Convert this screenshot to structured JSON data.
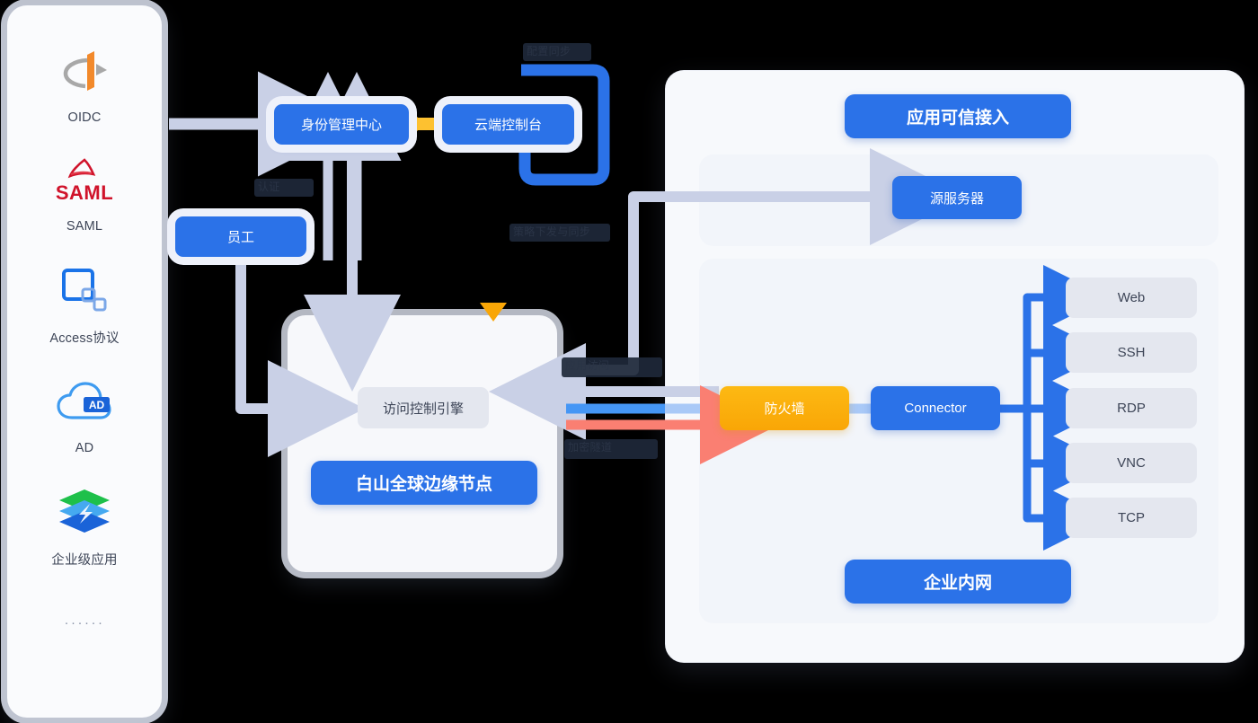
{
  "sidebar": {
    "items": [
      {
        "icon": "oidc-icon",
        "label": "OIDC"
      },
      {
        "icon": "saml-icon",
        "label": "SAML"
      },
      {
        "icon": "access-proto-icon",
        "label": "Access协议"
      },
      {
        "icon": "ad-icon",
        "label": "AD"
      },
      {
        "icon": "enterprise-app-icon",
        "label": "企业级应用"
      }
    ],
    "more": "······"
  },
  "nodes": {
    "identity_center": "身份管理中心",
    "cloud_console": "云端控制台",
    "employee": "员工",
    "access_control_engine": "访问控制引擎",
    "edge_node": "白山全球边缘节点",
    "trusted_access": "应用可信接入",
    "origin_server": "源服务器",
    "firewall": "防火墙",
    "connector": "Connector",
    "intranet": "企业内网"
  },
  "protocols": [
    {
      "label": "Web"
    },
    {
      "label": "SSH"
    },
    {
      "label": "RDP"
    },
    {
      "label": "VNC"
    },
    {
      "label": "TCP"
    }
  ],
  "edge_labels": {
    "console_loop": "配置同步",
    "employee_auth": "认证",
    "policy_push": "策略下发与同步",
    "app_access": "应用访问",
    "tunnel": "加密隧道"
  },
  "colors": {
    "brand_blue": "#2b72e8",
    "arrow_blue": "#4596f5",
    "arrow_red": "#fa7f72",
    "arrow_lavender": "#c9d0e6",
    "amber": "#fdb913",
    "panel_bg": "#f7f9fc",
    "chip_grey": "#e4e7ef"
  }
}
